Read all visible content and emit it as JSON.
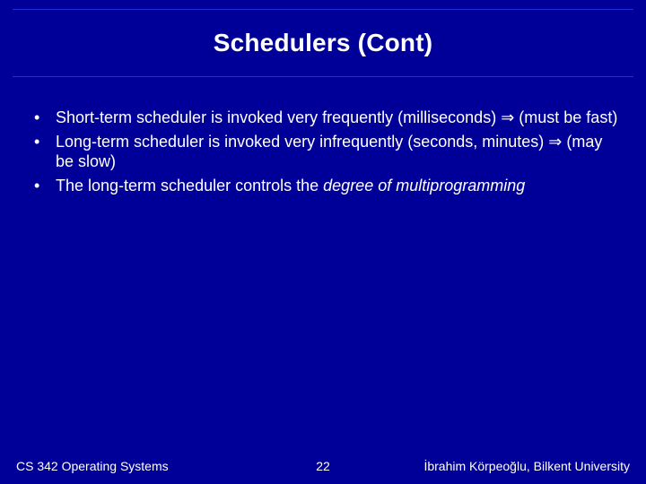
{
  "title": "Schedulers (Cont)",
  "bullets": [
    {
      "pre": "Short-term scheduler is invoked very frequently (milliseconds) ",
      "arrow": "⇒",
      "post": " (must be fast)"
    },
    {
      "pre": "Long-term scheduler is invoked very infrequently (seconds, minutes) ",
      "arrow": "⇒",
      "post": " (may be slow)"
    },
    {
      "pre": "The long-term scheduler controls the ",
      "italic": "degree of multiprogramming",
      "post": ""
    }
  ],
  "footer": {
    "left": "CS 342 Operating Systems",
    "center": "22",
    "right": "İbrahim Körpeoğlu, Bilkent University"
  }
}
